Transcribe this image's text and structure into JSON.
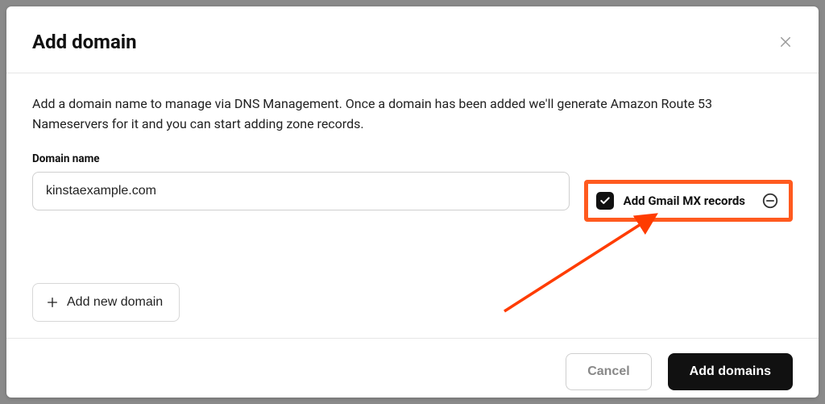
{
  "modal": {
    "title": "Add domain",
    "description": "Add a domain name to manage via DNS Management. Once a domain has been added we'll generate Amazon Route 53 Nameservers for it and you can start adding zone records.",
    "domain_field_label": "Domain name",
    "domain_value": "kinstaexample.com",
    "gmail_mx_label": "Add Gmail MX records",
    "gmail_mx_checked": true,
    "add_new_label": "Add new domain",
    "cancel_label": "Cancel",
    "submit_label": "Add domains"
  },
  "colors": {
    "highlight": "#ff5a1f",
    "primary_bg": "#111111"
  }
}
